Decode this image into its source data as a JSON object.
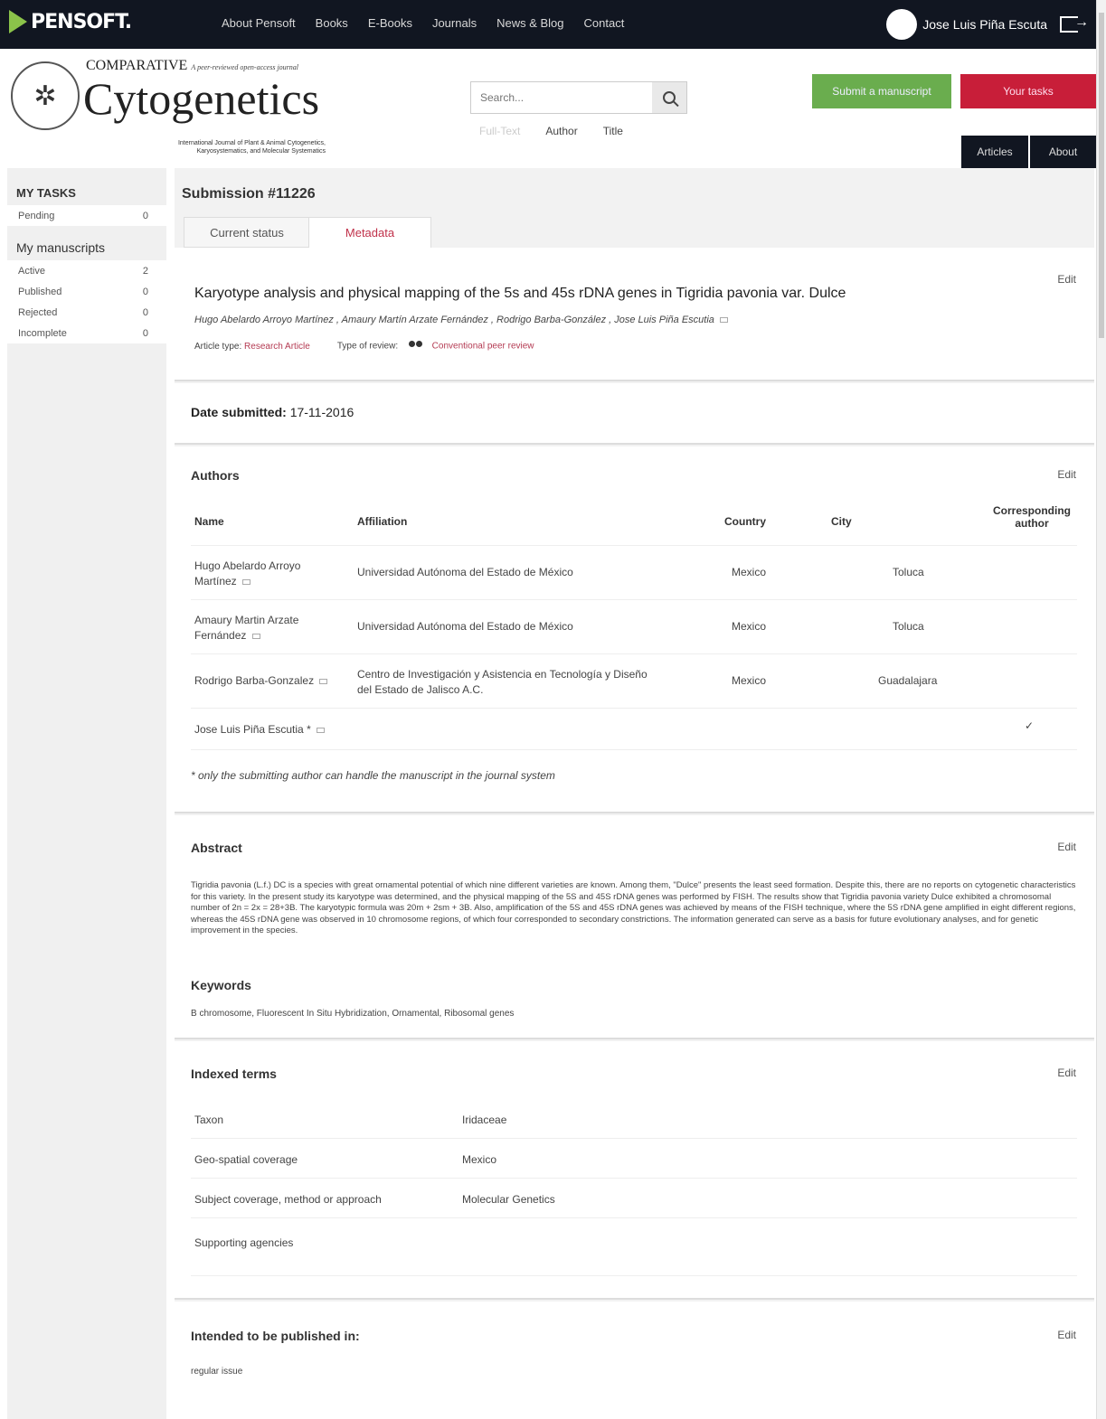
{
  "topbar": {
    "logo": "PENSOFT.",
    "nav": [
      "About Pensoft",
      "Books",
      "E-Books",
      "Journals",
      "News & Blog",
      "Contact"
    ],
    "user": "Jose Luis Piña Escuta"
  },
  "header": {
    "journal_small": "COMPARATIVE",
    "journal_tag": "A peer-reviewed open-access journal",
    "journal_title": "Cytogenetics",
    "journal_sub1": "International Journal of Plant & Animal Cytogenetics,",
    "journal_sub2": "Karyosystematics, and Molecular Systematics",
    "search_placeholder": "Search...",
    "search_opts": [
      "Full-Text",
      "Author",
      "Title"
    ],
    "submit_label": "Submit a manuscript",
    "tasks_label": "Your tasks",
    "articles_label": "Articles",
    "about_label": "About"
  },
  "sidebar": {
    "tasks_title": "MY TASKS",
    "tasks": [
      {
        "label": "Pending",
        "count": "0"
      }
    ],
    "manuscripts_title": "My manuscripts",
    "manuscripts": [
      {
        "label": "Active",
        "count": "2"
      },
      {
        "label": "Published",
        "count": "0"
      },
      {
        "label": "Rejected",
        "count": "0"
      },
      {
        "label": "Incomplete",
        "count": "0"
      }
    ]
  },
  "submission": {
    "title": "Submission #11226",
    "tabs": [
      "Current status",
      "Metadata"
    ],
    "edit_label": "Edit",
    "article_title": "Karyotype analysis and physical mapping of the 5s and 45s rDNA genes in Tigridia pavonia var. Dulce",
    "authors_line": "Hugo Abelardo Arroyo Martínez , Amaury Martín Arzate Fernández , Rodrigo Barba-González , Jose Luis Piña Escutia",
    "article_type_label": "Article type:",
    "article_type": "Research Article",
    "review_label": "Type of review:",
    "review_type": "Conventional peer review",
    "date_label": "Date submitted:",
    "date_value": "17-11-2016"
  },
  "authors": {
    "title": "Authors",
    "headers": [
      "Name",
      "Affiliation",
      "Country",
      "City",
      "Corresponding author"
    ],
    "rows": [
      {
        "name1": "Hugo Abelardo Arroyo",
        "name2": "Martínez",
        "affil1": "Universidad Autónoma del Estado de México",
        "affil2": "",
        "country": "Mexico",
        "city": "Toluca"
      },
      {
        "name1": "Amaury Martin Arzate",
        "name2": "Fernández",
        "affil1": "Universidad Autónoma del Estado de México",
        "affil2": "",
        "country": "Mexico",
        "city": "Toluca"
      },
      {
        "name1": "Rodrigo Barba-Gonzalez",
        "name2": "",
        "affil1": "Centro de Investigación y Asistencia en Tecnología y Diseño",
        "affil2": "del Estado de Jalisco A.C.",
        "country": "Mexico",
        "city": "Guadalajara"
      },
      {
        "name1": "Jose Luis Piña Escutia *",
        "name2": "",
        "affil1": "",
        "affil2": "",
        "country": "",
        "city": ""
      }
    ],
    "note": "* only the submitting author can handle the manuscript in the journal system"
  },
  "abstract": {
    "title": "Abstract",
    "text": "Tigridia pavonia (L.f.) DC is a species with great ornamental potential of which nine different varieties are known. Among them, \"Dulce\" presents the least seed formation. Despite this, there are no reports on cytogenetic characteristics for this variety. In the present study its karyotype was determined, and the physical mapping of the 5S and 45S rDNA genes was performed by FISH. The results show that Tigridia pavonia variety Dulce exhibited a chromosomal number of 2n = 2x = 28+3B. The karyotypic formula was 20m + 2sm + 3B. Also, amplification of the 5S and 45S rDNA genes was achieved by means of the FISH technique, where the 5S rDNA gene amplified in eight different regions, whereas the 45S rDNA gene was observed in 10 chromosome regions, of which four corresponded to secondary constrictions. The information generated can serve as a basis for future evolutionary analyses, and for genetic improvement in the species.",
    "keywords_title": "Keywords",
    "keywords": "B chromosome, Fluorescent In Situ Hybridization, Ornamental, Ribosomal genes"
  },
  "indexed": {
    "title": "Indexed terms",
    "rows": [
      {
        "k": "Taxon",
        "v": "Iridaceae"
      },
      {
        "k": "Geo-spatial coverage",
        "v": "Mexico"
      },
      {
        "k": "Subject coverage, method or approach",
        "v": "Molecular Genetics"
      },
      {
        "k": "Supporting agencies",
        "v": ""
      }
    ]
  },
  "publish": {
    "title": "Intended to be published in:",
    "value": "regular issue"
  }
}
